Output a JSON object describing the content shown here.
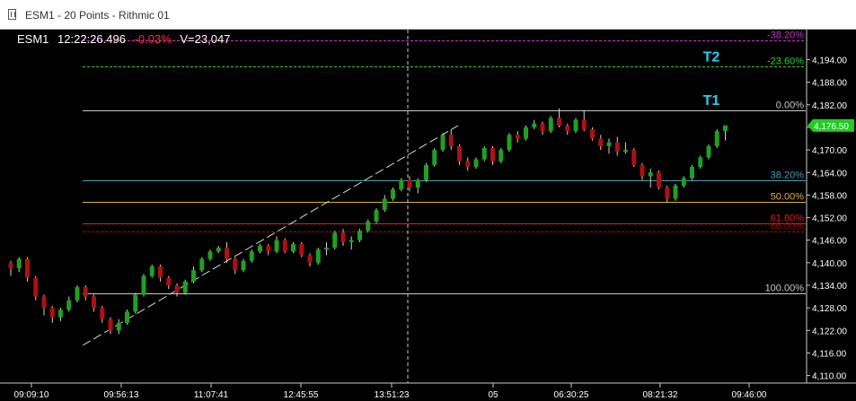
{
  "window": {
    "title": "ESM1 - 20 Points - Rithmic 01"
  },
  "header": {
    "symbol": "ESM1",
    "time": "12:22:26.496",
    "change": "-0.03%",
    "volume": "V=23,047",
    "change_color": "#ff3030"
  },
  "price_axis": {
    "labels": [
      "4,194.00",
      "4,188.00",
      "4,182.00",
      "4,176.00",
      "4,170.00",
      "4,164.00",
      "4,158.00",
      "4,152.00",
      "4,146.00",
      "4,140.00",
      "4,134.00",
      "4,128.00",
      "4,122.00",
      "4,116.00",
      "4,110.00"
    ],
    "last_price": "4,176.50",
    "last_price_color": "#22cc22"
  },
  "time_axis": {
    "labels": [
      "09:09:10",
      "09:56:13",
      "11:07:41",
      "12:45:55",
      "13:51:23",
      "05",
      "06:30:25",
      "08:21:32",
      "09:46:00"
    ]
  },
  "fib_levels": [
    {
      "label": "-38.20%",
      "price": 4199.2,
      "color": "#cc33cc",
      "dashed": true
    },
    {
      "label": "-23.60%",
      "price": 4192.1,
      "color": "#33cc33",
      "dashed": true
    },
    {
      "label": "0.00%",
      "price": 4180.5,
      "color": "#c8c8c8",
      "dashed": false
    },
    {
      "label": "38.20%",
      "price": 4161.8,
      "color": "#4a9fb5",
      "dashed": false
    },
    {
      "label": "50.00%",
      "price": 4156.1,
      "color": "#e0b030",
      "dashed": false
    },
    {
      "label": "61.80%",
      "price": 4150.4,
      "color": "#e02020",
      "dashed": false
    },
    {
      "label": "66.00%",
      "price": 4148.3,
      "color": "#a01010",
      "dashed": true
    },
    {
      "label": "100.00%",
      "price": 4131.8,
      "color": "#c8c8c8",
      "dashed": false
    }
  ],
  "targets": [
    {
      "label": "T2",
      "color": "#22d0f0"
    },
    {
      "label": "T1",
      "color": "#22d0f0"
    }
  ],
  "colors": {
    "up": "#1fa11f",
    "down": "#b01010",
    "wick": "#d0d0d0",
    "axis": "#cccccc"
  },
  "chart_data": {
    "type": "candlestick",
    "ylim": [
      4108,
      4202
    ],
    "candles": [
      [
        4140,
        4140.5,
        4136.5,
        4138.5
      ],
      [
        4138.5,
        4141.5,
        4137.5,
        4141
      ],
      [
        4141,
        4141.5,
        4135,
        4136
      ],
      [
        4136,
        4136.5,
        4130,
        4131
      ],
      [
        4131,
        4131.5,
        4126,
        4128
      ],
      [
        4128,
        4128.5,
        4124,
        4125.5
      ],
      [
        4125.5,
        4128,
        4124.5,
        4127.5
      ],
      [
        4127.5,
        4131,
        4127,
        4130
      ],
      [
        4130,
        4134,
        4129.5,
        4133.5
      ],
      [
        4133.5,
        4134,
        4130,
        4131
      ],
      [
        4131,
        4131.5,
        4127,
        4128
      ],
      [
        4128,
        4128.5,
        4124,
        4125
      ],
      [
        4125,
        4125.5,
        4121,
        4122
      ],
      [
        4122,
        4125,
        4121,
        4124
      ],
      [
        4124,
        4127.5,
        4123.5,
        4127
      ],
      [
        4127,
        4132,
        4126.5,
        4131.5
      ],
      [
        4131.5,
        4137,
        4131,
        4136.5
      ],
      [
        4136.5,
        4139.5,
        4136,
        4139
      ],
      [
        4139,
        4139.5,
        4135,
        4136
      ],
      [
        4136,
        4136.5,
        4133,
        4134
      ],
      [
        4134,
        4134.5,
        4131,
        4132
      ],
      [
        4132,
        4135.5,
        4131.5,
        4135
      ],
      [
        4135,
        4139,
        4134.5,
        4138
      ],
      [
        4138,
        4141.5,
        4137.5,
        4141
      ],
      [
        4141,
        4143.5,
        4140.5,
        4143
      ],
      [
        4143,
        4144.5,
        4142.5,
        4144
      ],
      [
        4144,
        4145.5,
        4140,
        4141
      ],
      [
        4141,
        4141.5,
        4137,
        4138
      ],
      [
        4138,
        4141,
        4137.5,
        4140.5
      ],
      [
        4140.5,
        4143.5,
        4140,
        4143
      ],
      [
        4143,
        4145,
        4142.5,
        4144.5
      ],
      [
        4144.5,
        4145,
        4142,
        4143
      ],
      [
        4143,
        4147,
        4142.5,
        4146
      ],
      [
        4146,
        4146.5,
        4142.5,
        4143
      ],
      [
        4143,
        4145.5,
        4142.5,
        4145
      ],
      [
        4145,
        4145.5,
        4141.5,
        4142
      ],
      [
        4142,
        4142.5,
        4139,
        4140
      ],
      [
        4140,
        4144,
        4139.5,
        4143.5
      ],
      [
        4143.5,
        4145.5,
        4142,
        4144
      ],
      [
        4144,
        4148.5,
        4143.5,
        4148
      ],
      [
        4148,
        4149,
        4144.5,
        4145.5
      ],
      [
        4145.5,
        4147,
        4143.5,
        4146
      ],
      [
        4146,
        4149,
        4145.5,
        4148.5
      ],
      [
        4148.5,
        4151.5,
        4148,
        4151
      ],
      [
        4151,
        4154.5,
        4150.5,
        4154
      ],
      [
        4154,
        4158,
        4153.5,
        4157
      ],
      [
        4157,
        4160,
        4156.5,
        4159.5
      ],
      [
        4159.5,
        4162.5,
        4159,
        4162
      ],
      [
        4162,
        4163,
        4159,
        4160
      ],
      [
        4160,
        4162.5,
        4158.5,
        4162
      ],
      [
        4162,
        4166.5,
        4161.5,
        4166
      ],
      [
        4166,
        4170.5,
        4165.5,
        4170
      ],
      [
        4170,
        4174.5,
        4169.5,
        4174
      ],
      [
        4174,
        4175.5,
        4170,
        4171
      ],
      [
        4171,
        4171.5,
        4166,
        4167
      ],
      [
        4167,
        4168,
        4164.5,
        4165.5
      ],
      [
        4165.5,
        4168,
        4165,
        4167.5
      ],
      [
        4167.5,
        4171,
        4167,
        4170.5
      ],
      [
        4170.5,
        4171,
        4166,
        4167
      ],
      [
        4167,
        4170.5,
        4166.5,
        4170
      ],
      [
        4170,
        4174.5,
        4169.5,
        4174
      ],
      [
        4174,
        4175,
        4172,
        4173
      ],
      [
        4173,
        4176.5,
        4172.5,
        4176
      ],
      [
        4176,
        4178,
        4175.5,
        4177
      ],
      [
        4177,
        4177.5,
        4174,
        4175
      ],
      [
        4175,
        4179,
        4174.5,
        4178.5
      ],
      [
        4178.5,
        4181,
        4176,
        4176.5
      ],
      [
        4176.5,
        4177,
        4174,
        4175
      ],
      [
        4175,
        4178.5,
        4174.5,
        4178
      ],
      [
        4178,
        4180.5,
        4175,
        4175.5
      ],
      [
        4175.5,
        4176,
        4172.5,
        4173
      ],
      [
        4173,
        4174,
        4170,
        4171
      ],
      [
        4171,
        4173,
        4169,
        4172
      ],
      [
        4172,
        4173.5,
        4168.5,
        4169.5
      ],
      [
        4169.5,
        4172,
        4169,
        4170
      ],
      [
        4170,
        4170.5,
        4165.5,
        4166
      ],
      [
        4166,
        4166.5,
        4162,
        4163
      ],
      [
        4163,
        4165,
        4160,
        4164
      ],
      [
        4164,
        4164.5,
        4159.5,
        4160
      ],
      [
        4160,
        4160.5,
        4156,
        4157
      ],
      [
        4157,
        4161,
        4156.5,
        4160.5
      ],
      [
        4160.5,
        4163,
        4160,
        4162.5
      ],
      [
        4162.5,
        4166,
        4162,
        4165.5
      ],
      [
        4165.5,
        4168.5,
        4165,
        4168
      ],
      [
        4168,
        4171.5,
        4167.5,
        4171
      ],
      [
        4171,
        4175.5,
        4170.5,
        4175
      ],
      [
        4175,
        4176.5,
        4172.5,
        4176.5
      ]
    ]
  }
}
